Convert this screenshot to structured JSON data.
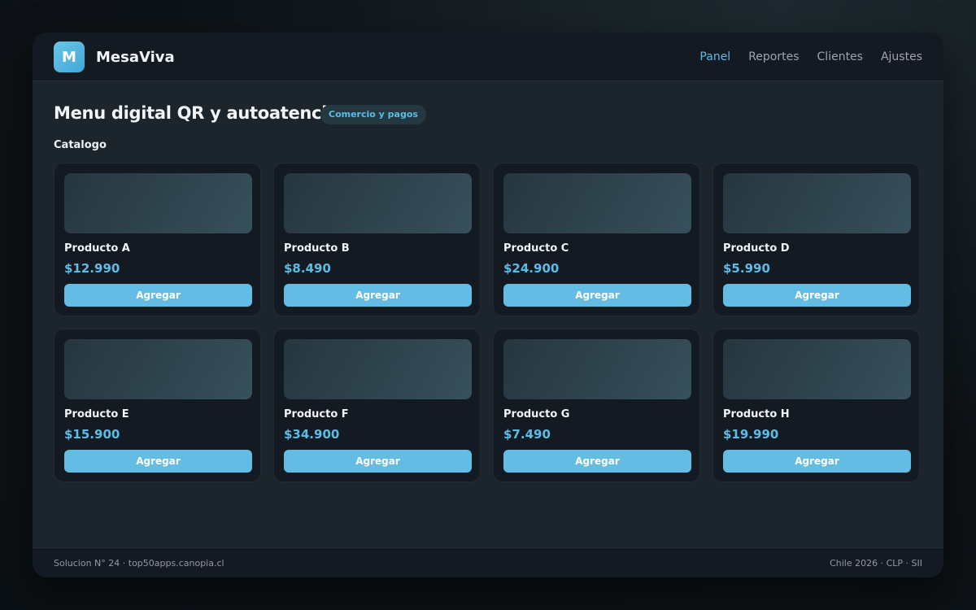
{
  "app": {
    "logo_letter": "M",
    "brand": "MesaViva"
  },
  "nav": {
    "items": [
      {
        "label": "Panel",
        "active": true
      },
      {
        "label": "Reportes",
        "active": false
      },
      {
        "label": "Clientes",
        "active": false
      },
      {
        "label": "Ajustes",
        "active": false
      }
    ]
  },
  "page": {
    "title": "Menu digital QR y autoatencion",
    "badge": "Comercio y pagos",
    "section_title": "Catalogo"
  },
  "products": [
    {
      "name": "Producto A",
      "price": "$12.990",
      "button": "Agregar"
    },
    {
      "name": "Producto B",
      "price": "$8.490",
      "button": "Agregar"
    },
    {
      "name": "Producto C",
      "price": "$24.900",
      "button": "Agregar"
    },
    {
      "name": "Producto D",
      "price": "$5.990",
      "button": "Agregar"
    },
    {
      "name": "Producto E",
      "price": "$15.900",
      "button": "Agregar"
    },
    {
      "name": "Producto F",
      "price": "$34.900",
      "button": "Agregar"
    },
    {
      "name": "Producto G",
      "price": "$7.490",
      "button": "Agregar"
    },
    {
      "name": "Producto H",
      "price": "$19.990",
      "button": "Agregar"
    }
  ],
  "footer": {
    "left": "Solucion N° 24 · top50apps.canopia.cl",
    "right": "Chile 2026 · CLP · SII"
  },
  "colors": {
    "accent": "#5bbde6",
    "button": "#62bce3",
    "card_bg": "#141a21",
    "panel_bg": "#1c252b"
  }
}
